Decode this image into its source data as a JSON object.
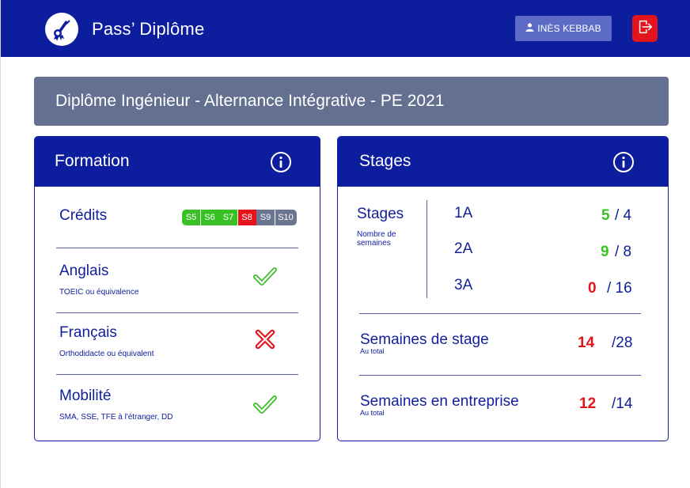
{
  "header": {
    "app_title": "Pass’ Diplôme",
    "user_label": "INÈS KEBBAB",
    "logo_icon": "diploma-icon",
    "user_icon": "user-icon",
    "logout_icon": "logout-icon"
  },
  "program": {
    "title": "Diplôme Ingénieur - Alternance Intégrative - PE 2021"
  },
  "formation": {
    "title": "Formation",
    "credits": {
      "label": "Crédits",
      "semesters": [
        {
          "label": "S5",
          "status": "validated",
          "color": "#38c025"
        },
        {
          "label": "S6",
          "status": "validated",
          "color": "#38c025"
        },
        {
          "label": "S7",
          "status": "validated",
          "color": "#38c025"
        },
        {
          "label": "S8",
          "status": "failed",
          "color": "#e4141c"
        },
        {
          "label": "S9",
          "status": "pending",
          "color": "#6a7590"
        },
        {
          "label": "S10",
          "status": "pending",
          "color": "#6a7590"
        }
      ]
    },
    "items": [
      {
        "label": "Anglais",
        "sub": "TOEIC ou équivalence",
        "status": "validated",
        "icon": "check-icon"
      },
      {
        "label": "Français",
        "sub": "Orthodidacte ou équivalent",
        "status": "not-validated",
        "icon": "cross-icon"
      },
      {
        "label": "Mobilité",
        "sub": "SMA, SSE, TFE à l'étranger, DD",
        "status": "validated",
        "icon": "check-icon"
      }
    ]
  },
  "stages": {
    "title": "Stages",
    "block": {
      "label": "Stages",
      "sub": "Nombre de semaines",
      "rows": [
        {
          "year": "1A",
          "done": "5",
          "total": "/ 4",
          "color": "#38c025"
        },
        {
          "year": "2A",
          "done": "9",
          "total": "/ 8",
          "color": "#38c025"
        },
        {
          "year": "3A",
          "done": "0",
          "total": "/ 16",
          "color": "#e4141c"
        }
      ]
    },
    "totals": [
      {
        "label": "Semaines de stage",
        "sub": "Au total",
        "done": "14",
        "total": "/28"
      },
      {
        "label": "Semaines en entreprise",
        "sub": "Au total",
        "done": "12",
        "total": "/14"
      }
    ]
  },
  "colors": {
    "brand": "#0c1e9e",
    "success": "#38c025",
    "danger": "#e4141c",
    "muted": "#64708f"
  }
}
